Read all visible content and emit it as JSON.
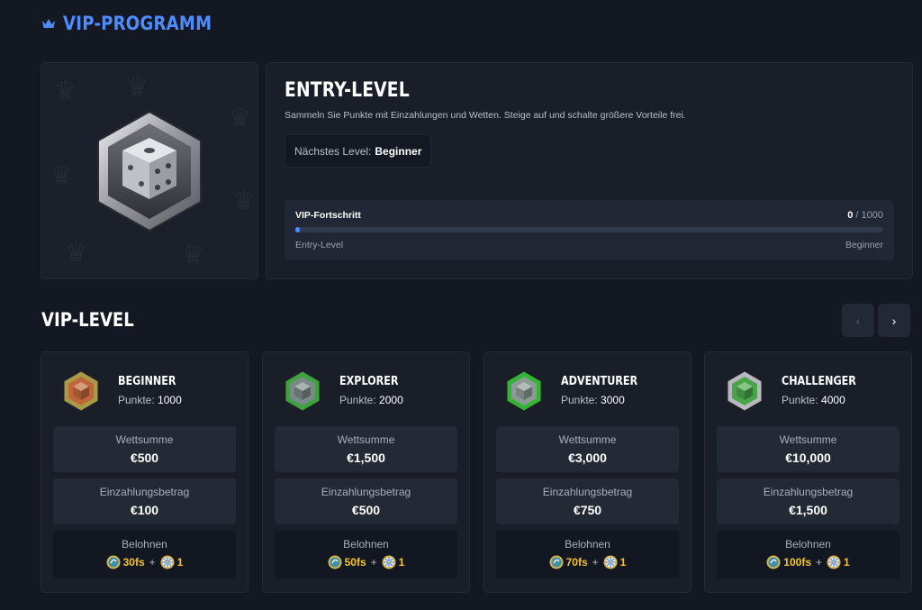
{
  "header": {
    "title": "VIP-PROGRAMM"
  },
  "current": {
    "level": "ENTRY-LEVEL",
    "description": "Sammeln Sie Punkte mit Einzahlungen und Wetten. Steige auf und schalte größere Vorteile frei.",
    "next_label": "Nächstes Level:",
    "next_value": "Beginner"
  },
  "progress": {
    "label": "VIP-Fortschritt",
    "current": "0",
    "sep": " / ",
    "total": "1000",
    "fraction": 0.0,
    "from": "Entry-Level",
    "to": "Beginner"
  },
  "section": {
    "title": "VIP-LEVEL"
  },
  "nav": {
    "prev_icon": "‹",
    "next_icon": "›"
  },
  "labels": {
    "points": "Punkte:",
    "wager": "Wettsumme",
    "deposit": "Einzahlungsbetrag",
    "reward": "Belohnen",
    "plus": "+"
  },
  "levels": [
    {
      "name": "BEGINNER",
      "points": "1000",
      "wager": "€500",
      "deposit": "€100",
      "freespins": "30fs",
      "wheel": "1",
      "gem_color": "#c0673a",
      "frame_color": "#a89a48"
    },
    {
      "name": "EXPLORER",
      "points": "2000",
      "wager": "€1,500",
      "deposit": "€500",
      "freespins": "50fs",
      "wheel": "1",
      "gem_color": "#7a8a86",
      "frame_color": "#3ea33e"
    },
    {
      "name": "ADVENTURER",
      "points": "3000",
      "wager": "€3,000",
      "deposit": "€750",
      "freespins": "70fs",
      "wheel": "1",
      "gem_color": "#8c9a96",
      "frame_color": "#34b434"
    },
    {
      "name": "CHALLENGER",
      "points": "4000",
      "wager": "€10,000",
      "deposit": "€1,500",
      "freespins": "100fs",
      "wheel": "1",
      "gem_color": "#4aa44a",
      "frame_color": "#b8b8c0"
    }
  ],
  "colors": {
    "accent": "#4f8cff",
    "background": "#141823",
    "reward": "#f4c430"
  }
}
